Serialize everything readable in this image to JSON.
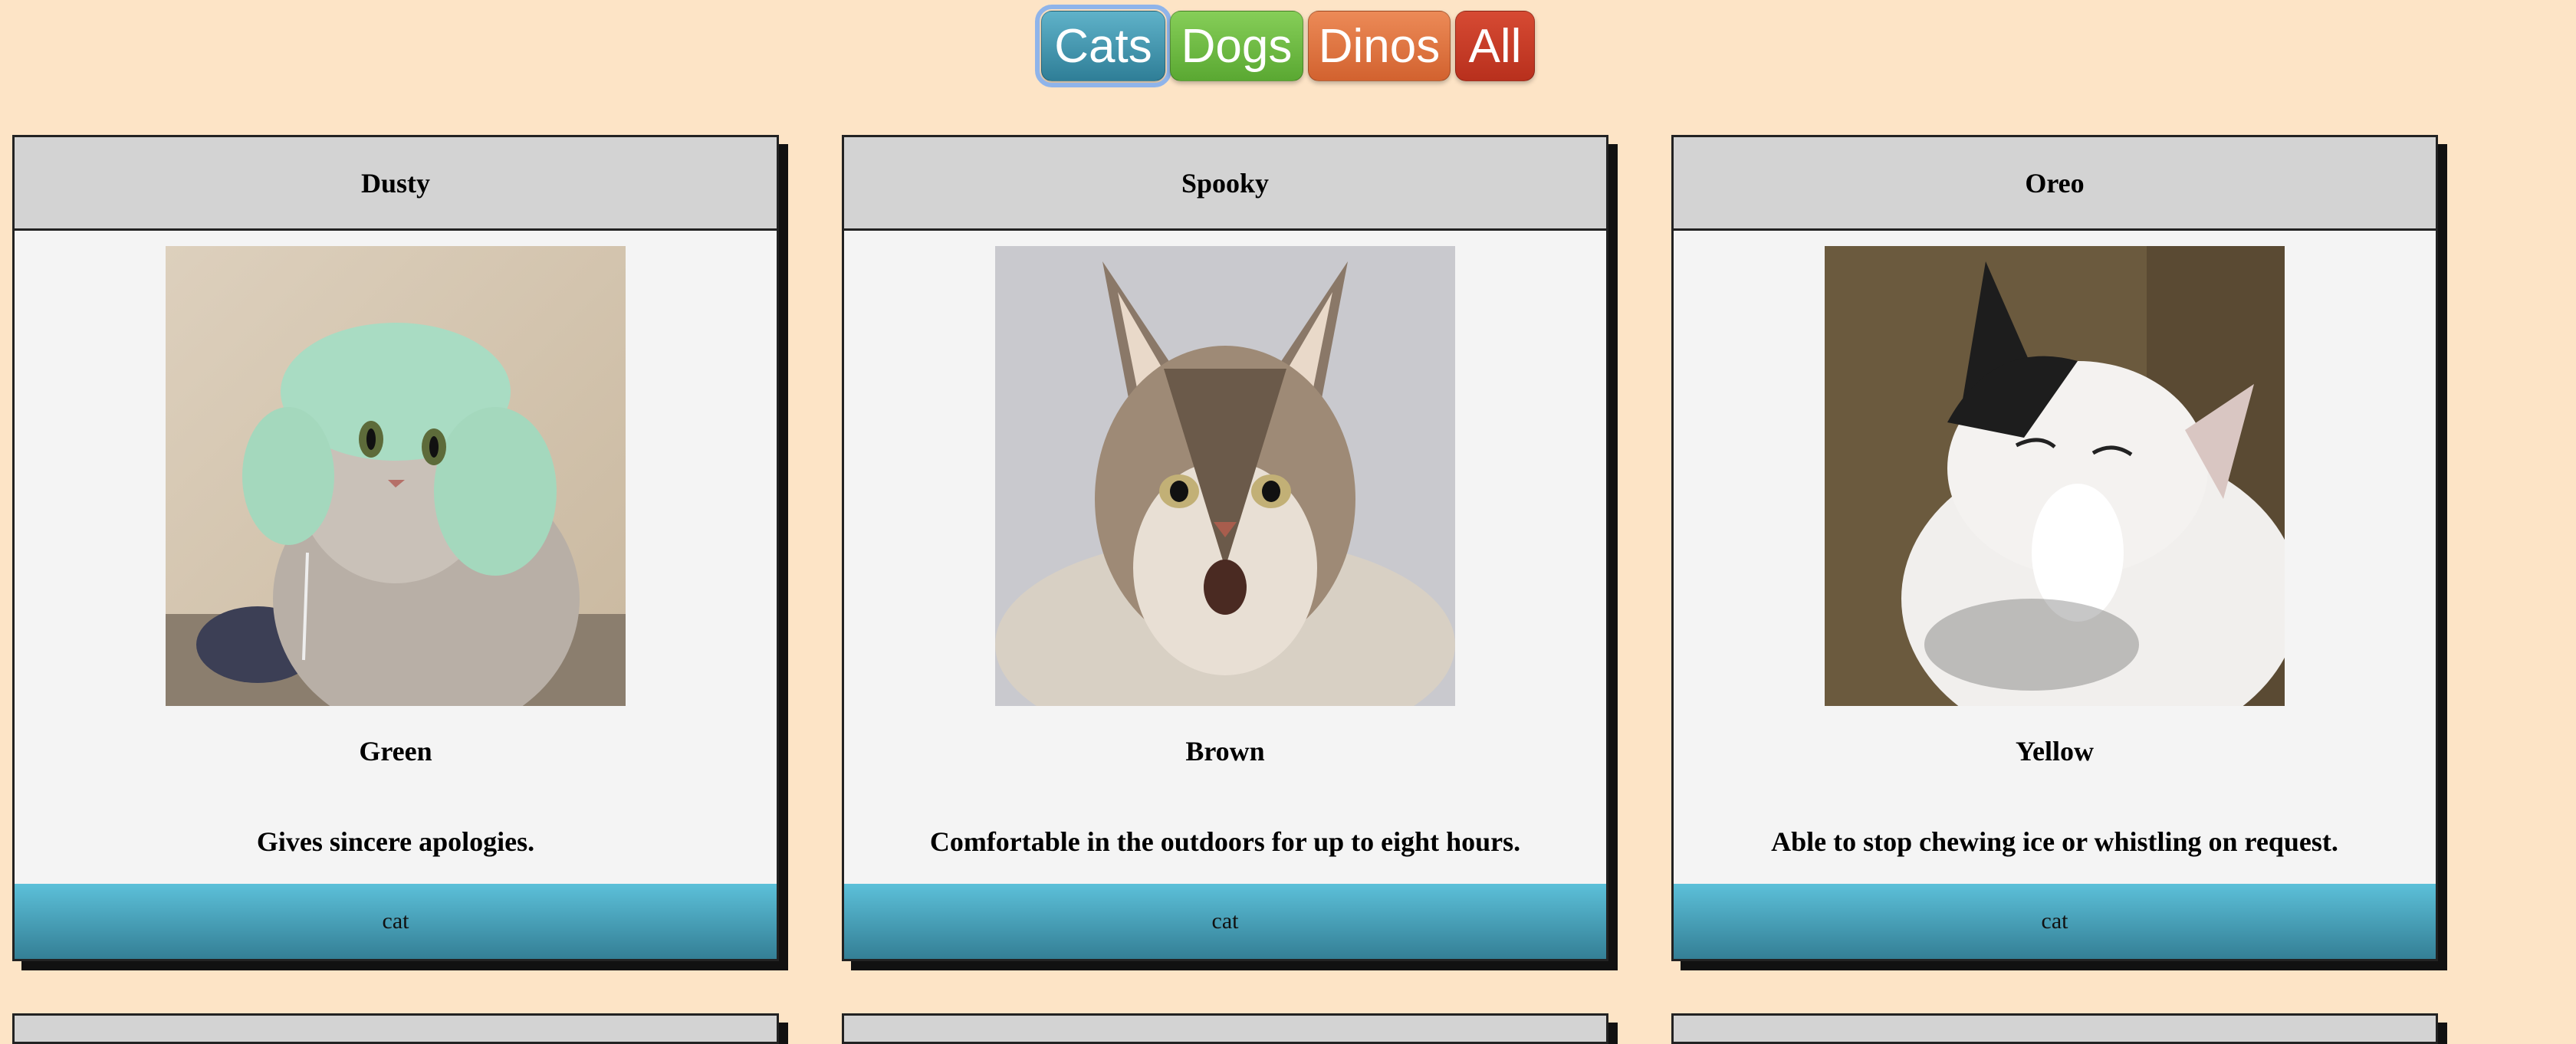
{
  "filters": {
    "cats": "Cats",
    "dogs": "Dogs",
    "dinos": "Dinos",
    "all": "All"
  },
  "cards": [
    {
      "name": "Dusty",
      "image": "cat-in-green-knit-hat",
      "color": "Green",
      "description": "Gives sincere apologies.",
      "type": "cat"
    },
    {
      "name": "Spooky",
      "image": "maine-coon-cat-face",
      "color": "Brown",
      "description": "Comfortable in the outdoors for up to eight hours.",
      "type": "cat"
    },
    {
      "name": "Oreo",
      "image": "black-white-cat-laughing",
      "color": "Yellow",
      "description": "Able to stop chewing ice or whistling on request.",
      "type": "cat"
    }
  ]
}
